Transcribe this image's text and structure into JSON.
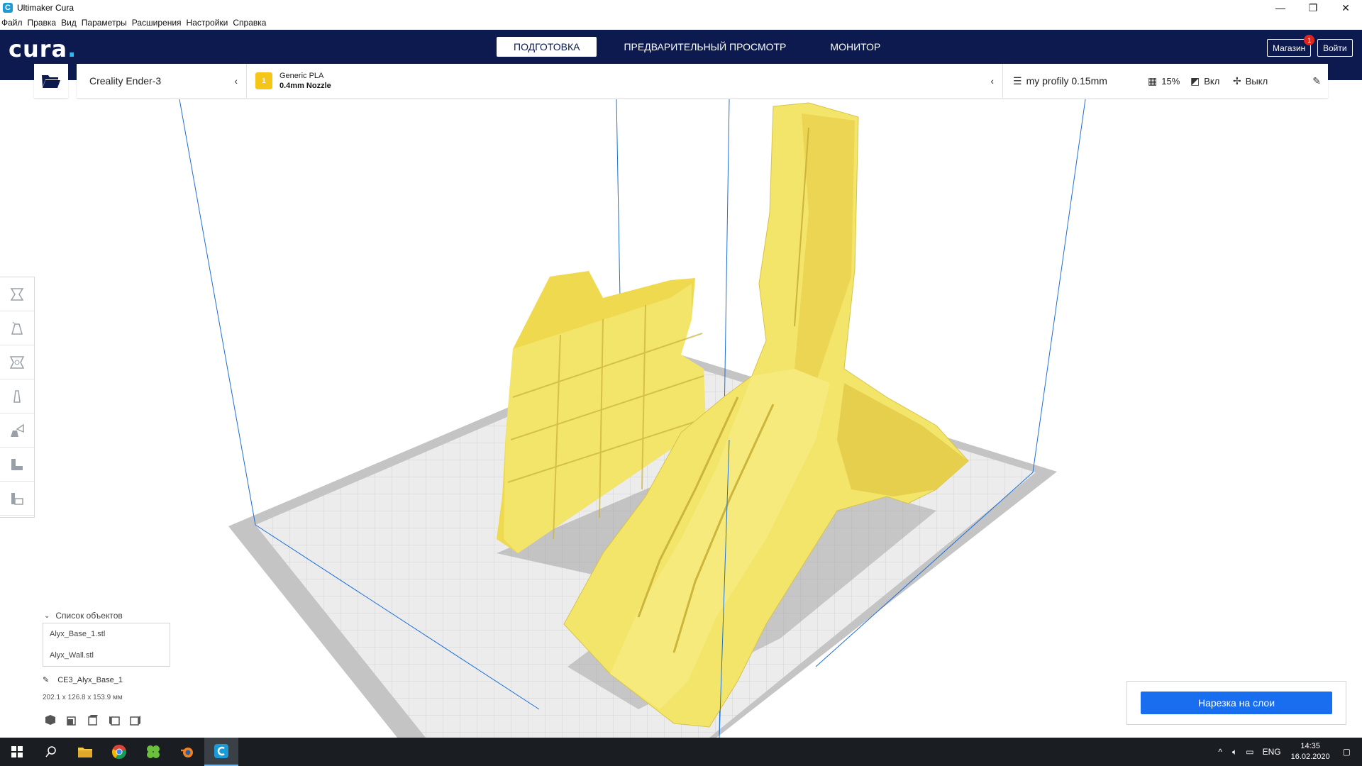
{
  "window": {
    "title": "Ultimaker Cura",
    "icon_letter": "C",
    "controls": [
      "—",
      "❐",
      "✕"
    ]
  },
  "menu": [
    "Файл",
    "Правка",
    "Вид",
    "Параметры",
    "Расширения",
    "Настройки",
    "Справка"
  ],
  "header": {
    "logo": "cura",
    "logo_dot": ".",
    "tabs": [
      {
        "label": "ПОДГОТОВКА",
        "active": true
      },
      {
        "label": "ПРЕДВАРИТЕЛЬНЫЙ ПРОСМОТР",
        "active": false
      },
      {
        "label": "МОНИТОР",
        "active": false
      }
    ],
    "store_label": "Магазин",
    "store_badge": "1",
    "signin_label": "Войти"
  },
  "machine": {
    "printer": "Creality Ender-3",
    "extruder_number": "1",
    "material": "Generic PLA",
    "nozzle": "0.4mm Nozzle"
  },
  "profile": {
    "name": "my profily 0.15mm",
    "infill": "15%",
    "support": "Вкл",
    "adhesion": "Выкл"
  },
  "left_tools": [
    "move-icon",
    "scale-icon",
    "rotate-icon",
    "mirror-icon",
    "per-model-settings-icon",
    "support-blocker-icon",
    "layer-tool-icon"
  ],
  "object_list": {
    "title": "Список объектов",
    "items": [
      "Alyx_Base_1.stl",
      "Alyx_Wall.stl"
    ],
    "selected_name": "CE3_Alyx_Base_1",
    "dimensions": "202.1 x 126.8 x 153.9 мм"
  },
  "slice_button": "Нарезка на слои",
  "taskbar": {
    "language": "ENG",
    "time": "14:35",
    "date": "16.02.2020"
  },
  "colors": {
    "header_bg": "#0c1a4f",
    "model_yellow": "#f3e46a",
    "slice_blue": "#196ef0",
    "taskbar_bg": "#1a1d22"
  }
}
